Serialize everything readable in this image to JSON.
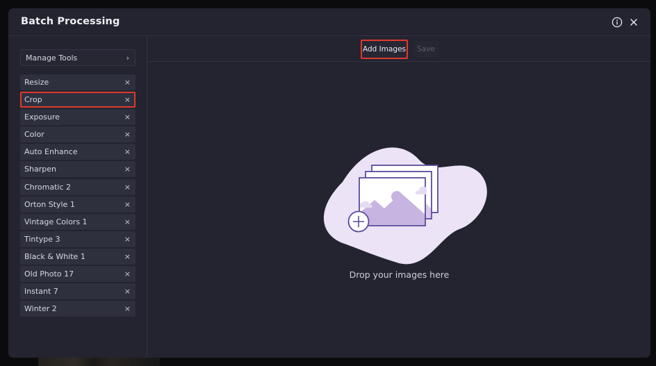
{
  "modal": {
    "title": "Batch Processing",
    "info_icon": "info-circle-icon",
    "close_icon": "close-icon"
  },
  "sidebar": {
    "manage_tools": {
      "label": "Manage Tools",
      "icon": "chevron-right-icon",
      "glyph": "›"
    },
    "remove_glyph": "×",
    "tools": [
      {
        "label": "Resize",
        "highlighted": false
      },
      {
        "label": "Crop",
        "highlighted": true
      },
      {
        "label": "Exposure",
        "highlighted": false
      },
      {
        "label": "Color",
        "highlighted": false
      },
      {
        "label": "Auto Enhance",
        "highlighted": false
      },
      {
        "label": "Sharpen",
        "highlighted": false
      },
      {
        "label": "Chromatic 2",
        "highlighted": false
      },
      {
        "label": "Orton Style 1",
        "highlighted": false
      },
      {
        "label": "Vintage Colors 1",
        "highlighted": false
      },
      {
        "label": "Tintype 3",
        "highlighted": false
      },
      {
        "label": "Black & White 1",
        "highlighted": false
      },
      {
        "label": "Old Photo 17",
        "highlighted": false
      },
      {
        "label": "Instant 7",
        "highlighted": false
      },
      {
        "label": "Winter 2",
        "highlighted": false
      }
    ]
  },
  "toolbar": {
    "add_images_label": "Add Images",
    "save_label": "Save",
    "save_disabled": true
  },
  "dropzone": {
    "text": "Drop your images here",
    "illustration": "image-stack-add-icon"
  },
  "colors": {
    "highlight": "#e0392b",
    "blob": "#ece3f6",
    "accent_purple": "#5a4a9c",
    "mountain": "#c8b4e0"
  }
}
